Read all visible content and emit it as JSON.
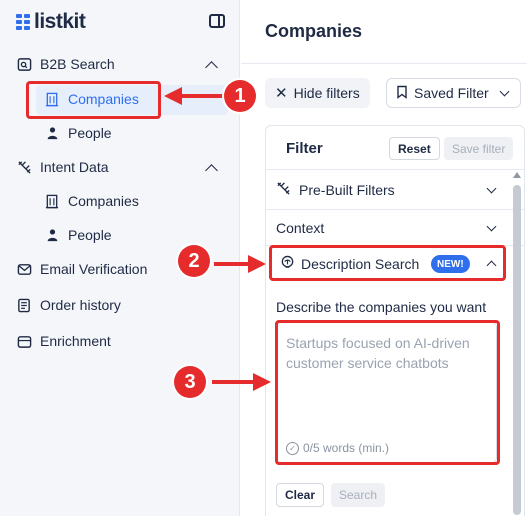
{
  "app": {
    "logo_text": "listkit"
  },
  "sidebar": {
    "groups": [
      {
        "label": "B2B Search",
        "items": [
          {
            "label": "Companies"
          },
          {
            "label": "People"
          }
        ]
      },
      {
        "label": "Intent Data",
        "items": [
          {
            "label": "Companies"
          },
          {
            "label": "People"
          }
        ]
      }
    ],
    "links": [
      {
        "label": "Email Verification"
      },
      {
        "label": "Order history"
      },
      {
        "label": "Enrichment"
      }
    ]
  },
  "main": {
    "title": "Companies",
    "toolbar": {
      "hide_filters_label": "Hide filters",
      "saved_filter_label": "Saved Filter"
    },
    "filter": {
      "title": "Filter",
      "reset_label": "Reset",
      "save_filter_label": "Save filter",
      "sections": [
        {
          "label": "Pre-Built Filters"
        },
        {
          "label": "Context"
        },
        {
          "label": "Description Search",
          "badge": "NEW!"
        }
      ],
      "description": {
        "label": "Describe the companies you want",
        "placeholder": "Startups focused on AI-driven customer service chatbots",
        "word_count": "0/5 words (min.)",
        "clear_label": "Clear",
        "search_label": "Search"
      }
    }
  },
  "annotations": {
    "steps": [
      "1",
      "2",
      "3"
    ],
    "color": "#e52b2b"
  },
  "colors": {
    "accent": "#2f6fec",
    "annotation": "#e52b2b"
  }
}
